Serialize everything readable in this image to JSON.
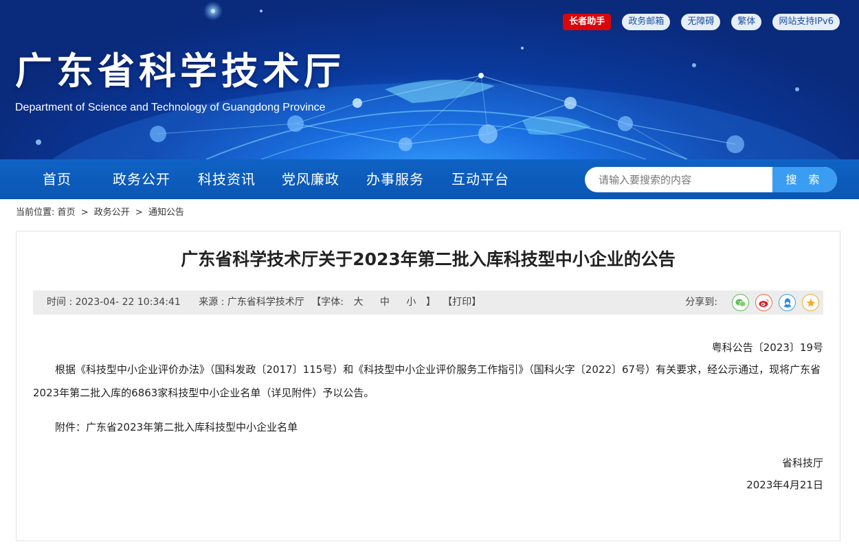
{
  "header": {
    "title": "广东省科学技术厅",
    "subtitle": "Department of Science and Technology of Guangdong Province",
    "top_links": [
      "长者助手",
      "政务邮箱",
      "无障碍",
      "繁体",
      "网站支持IPv6"
    ]
  },
  "nav": {
    "items": [
      "首页",
      "政务公开",
      "科技资讯",
      "党风廉政",
      "办事服务",
      "互动平台"
    ],
    "search_placeholder": "请输入要搜索的内容",
    "search_button": "搜 索"
  },
  "breadcrumb": {
    "prefix": "当前位置:",
    "items": [
      "首页",
      "政务公开",
      "通知公告"
    ],
    "separator": ">"
  },
  "article": {
    "title": "广东省科学技术厅关于2023年第二批入库科技型中小企业的公告",
    "meta": {
      "time": "时间 : 2023-04- 22 10:34:41",
      "source": "来源 : 广东省科学技术厅",
      "font_label": "【字体:",
      "font_large": "大",
      "font_medium": "中",
      "font_small": "小",
      "font_close": "】",
      "print": "【打印】",
      "share_label": "分享到:"
    },
    "doc_number": "粤科公告〔2023〕19号",
    "paragraph1": "根据《科技型中小企业评价办法》（国科发政〔2017〕115号）和《科技型中小企业评价服务工作指引》（国科火字〔2022〕67号）有关要求，经公示通过，现将广东省2023年第二批入库的6863家科技型中小企业名单（详见附件）予以公告。",
    "attachment": "附件：广东省2023年第二批入库科技型中小企业名单",
    "signature": "省科技厅",
    "date": "2023年4月21日"
  },
  "colors": {
    "nav_blue": "#0f62c4",
    "search_button": "#3b9df2",
    "elder_helper_red": "#d9070b"
  },
  "icons": [
    "wechat-icon",
    "weibo-icon",
    "qq-icon",
    "favorite-icon"
  ]
}
